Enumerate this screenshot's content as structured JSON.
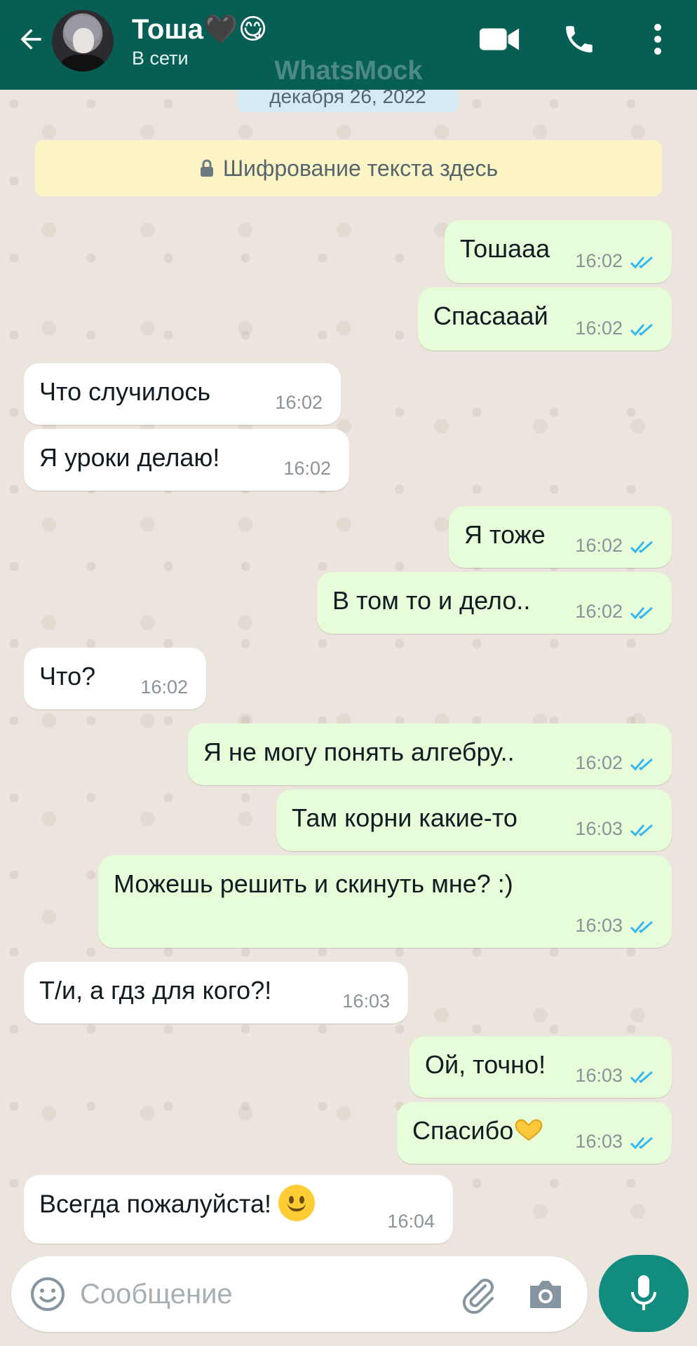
{
  "header": {
    "contact_name": "Тоша🖤😋",
    "status": "В сети"
  },
  "watermark": "WhatsMock",
  "date_chip": "декабря 26, 2022",
  "encryption": "Шифрование текста здесь",
  "messages": [
    {
      "dir": "out",
      "text": "Тошааа",
      "time": "16:02"
    },
    {
      "dir": "out",
      "text": "Спасааай",
      "time": "16:02"
    },
    {
      "dir": "in",
      "text": "Что случилось",
      "time": "16:02"
    },
    {
      "dir": "in",
      "text": "Я уроки делаю!",
      "time": "16:02"
    },
    {
      "dir": "out",
      "text": "Я тоже",
      "time": "16:02"
    },
    {
      "dir": "out",
      "text": "В том то и дело..",
      "time": "16:02"
    },
    {
      "dir": "in",
      "text": "Что?",
      "time": "16:02"
    },
    {
      "dir": "out",
      "text": "Я не могу понять алгебру..",
      "time": "16:02"
    },
    {
      "dir": "out",
      "text": "Там корни какие-то",
      "time": "16:03"
    },
    {
      "dir": "out",
      "text": "Можешь решить и скинуть мне? :)",
      "time": "16:03"
    },
    {
      "dir": "in",
      "text": "Т/и, а гдз для кого?!",
      "time": "16:03"
    },
    {
      "dir": "out",
      "text": "Ой, точно!",
      "time": "16:03"
    },
    {
      "dir": "out",
      "text": "Спасибо",
      "time": "16:03",
      "emoji": "heart-hands"
    },
    {
      "dir": "in",
      "text": "Всегда пожалуйста!",
      "time": "16:04",
      "emoji": "slightly-smiling-face"
    }
  ],
  "composer": {
    "placeholder": "Сообщение"
  },
  "colors": {
    "header": "#075e54",
    "outgoing_bubble": "#e7fcd8",
    "incoming_bubble": "#ffffff",
    "read_ticks": "#34b7f1",
    "mic_button": "#128c7e",
    "encryption_notice": "#fdf4c5"
  }
}
